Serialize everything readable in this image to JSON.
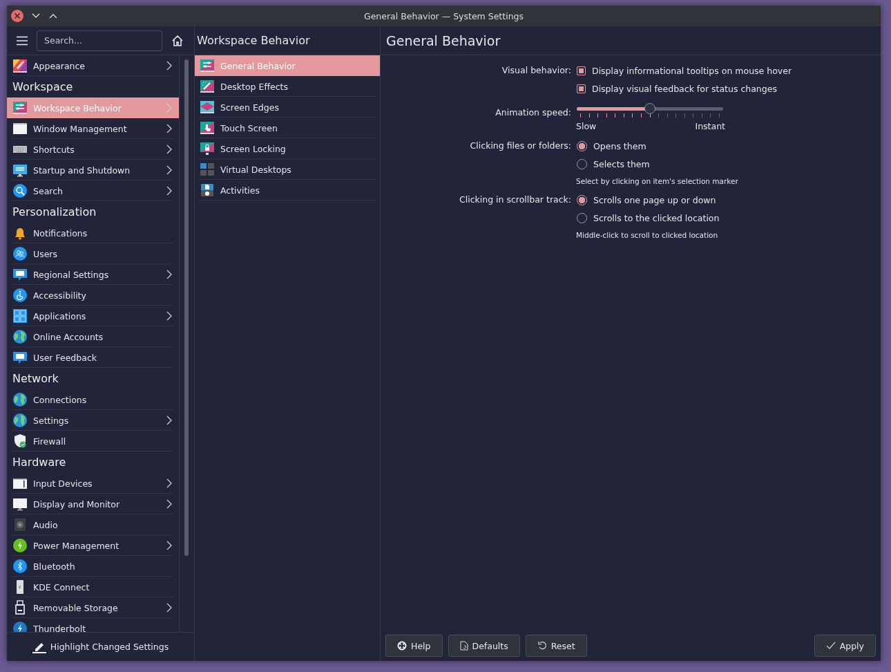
{
  "window": {
    "title": "General Behavior — System Settings"
  },
  "sidebar": {
    "search": {
      "placeholder": "Search..."
    },
    "items": [
      {
        "kind": "item",
        "label": "Appearance",
        "expandable": true,
        "selected": false
      },
      {
        "kind": "header",
        "label": "Workspace"
      },
      {
        "kind": "item",
        "label": "Workspace Behavior",
        "expandable": true,
        "selected": true
      },
      {
        "kind": "item",
        "label": "Window Management",
        "expandable": true,
        "selected": false
      },
      {
        "kind": "item",
        "label": "Shortcuts",
        "expandable": true,
        "selected": false
      },
      {
        "kind": "item",
        "label": "Startup and Shutdown",
        "expandable": true,
        "selected": false
      },
      {
        "kind": "item",
        "label": "Search",
        "expandable": true,
        "selected": false
      },
      {
        "kind": "header",
        "label": "Personalization"
      },
      {
        "kind": "item",
        "label": "Notifications",
        "expandable": false,
        "selected": false
      },
      {
        "kind": "item",
        "label": "Users",
        "expandable": false,
        "selected": false
      },
      {
        "kind": "item",
        "label": "Regional Settings",
        "expandable": true,
        "selected": false
      },
      {
        "kind": "item",
        "label": "Accessibility",
        "expandable": false,
        "selected": false
      },
      {
        "kind": "item",
        "label": "Applications",
        "expandable": true,
        "selected": false
      },
      {
        "kind": "item",
        "label": "Online Accounts",
        "expandable": false,
        "selected": false
      },
      {
        "kind": "item",
        "label": "User Feedback",
        "expandable": false,
        "selected": false
      },
      {
        "kind": "header",
        "label": "Network"
      },
      {
        "kind": "item",
        "label": "Connections",
        "expandable": false,
        "selected": false
      },
      {
        "kind": "item",
        "label": "Settings",
        "expandable": true,
        "selected": false
      },
      {
        "kind": "item",
        "label": "Firewall",
        "expandable": false,
        "selected": false
      },
      {
        "kind": "header",
        "label": "Hardware"
      },
      {
        "kind": "item",
        "label": "Input Devices",
        "expandable": true,
        "selected": false
      },
      {
        "kind": "item",
        "label": "Display and Monitor",
        "expandable": true,
        "selected": false
      },
      {
        "kind": "item",
        "label": "Audio",
        "expandable": false,
        "selected": false
      },
      {
        "kind": "item",
        "label": "Power Management",
        "expandable": true,
        "selected": false
      },
      {
        "kind": "item",
        "label": "Bluetooth",
        "expandable": false,
        "selected": false
      },
      {
        "kind": "item",
        "label": "KDE Connect",
        "expandable": false,
        "selected": false
      },
      {
        "kind": "item",
        "label": "Removable Storage",
        "expandable": true,
        "selected": false
      },
      {
        "kind": "item",
        "label": "Thunderbolt",
        "expandable": false,
        "selected": false
      }
    ],
    "footer": "Highlight Changed Settings"
  },
  "category": {
    "title": "Workspace Behavior",
    "items": [
      {
        "label": "General Behavior",
        "selected": true
      },
      {
        "label": "Desktop Effects",
        "selected": false
      },
      {
        "label": "Screen Edges",
        "selected": false
      },
      {
        "label": "Touch Screen",
        "selected": false
      },
      {
        "label": "Screen Locking",
        "selected": false
      },
      {
        "label": "Virtual Desktops",
        "selected": false
      },
      {
        "label": "Activities",
        "selected": false
      }
    ]
  },
  "page": {
    "title": "General Behavior",
    "rows": [
      {
        "kind": "checkboxes",
        "label": "Visual behavior:",
        "options": [
          {
            "label": "Display informational tooltips on mouse hover",
            "checked": true
          },
          {
            "label": "Display visual feedback for status changes",
            "checked": true
          }
        ]
      },
      {
        "kind": "slider",
        "label": "Animation speed:",
        "level": 0.5,
        "min_label": "Slow",
        "max_label": "Instant"
      },
      {
        "kind": "radios",
        "label": "Clicking files or folders:",
        "options": [
          {
            "label": "Opens them",
            "selected": true
          },
          {
            "label": "Selects them",
            "selected": false
          }
        ],
        "hint": "Select by clicking on item's selection marker"
      },
      {
        "kind": "radios",
        "label": "Clicking in scrollbar track:",
        "options": [
          {
            "label": "Scrolls one page up or down",
            "selected": true
          },
          {
            "label": "Scrolls to the clicked location",
            "selected": false
          }
        ],
        "hint": "Middle-click to scroll to clicked location"
      }
    ]
  },
  "buttons": [
    {
      "kind": "help",
      "label": "Help"
    },
    {
      "kind": "defaults",
      "label": "Defaults"
    },
    {
      "kind": "reset",
      "label": "Reset"
    },
    {
      "kind": "apply",
      "label": "Apply"
    }
  ]
}
